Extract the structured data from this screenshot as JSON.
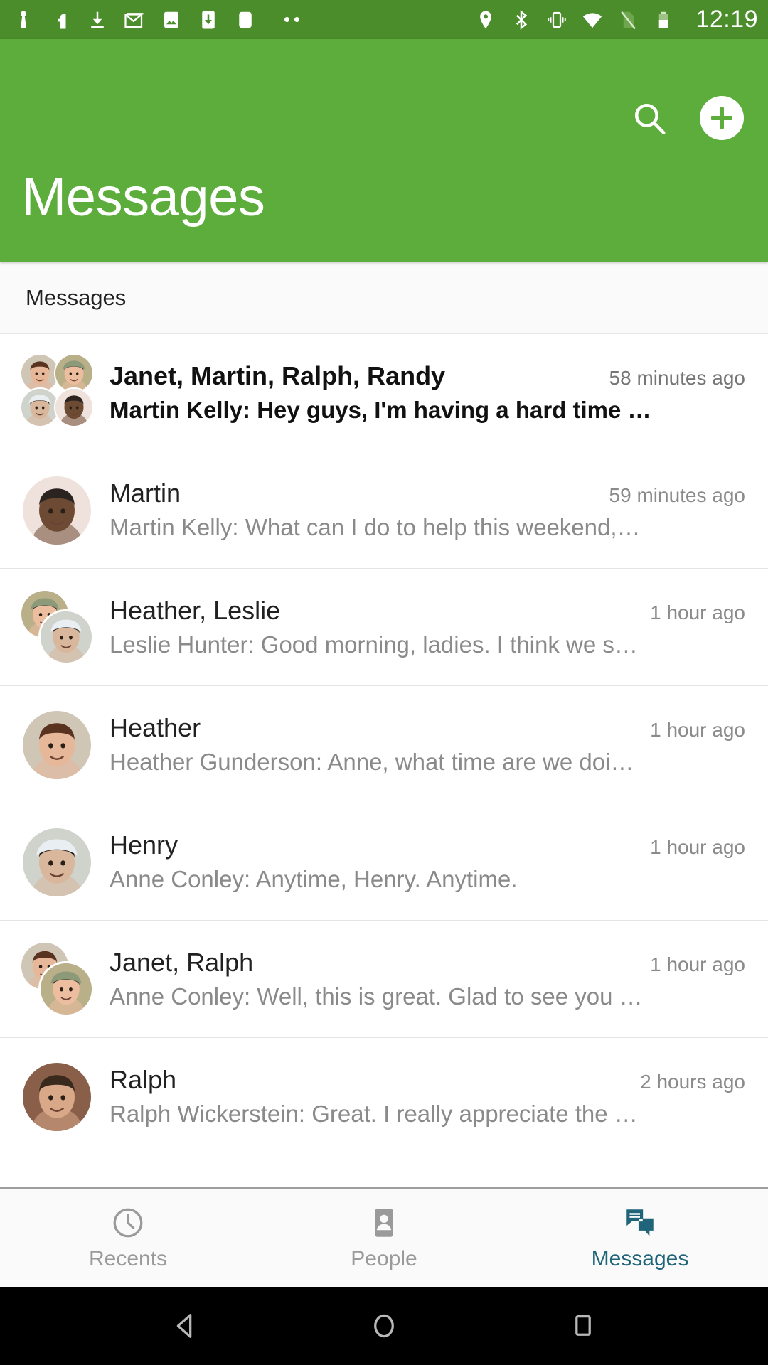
{
  "status_bar": {
    "time": "12:19",
    "background_color": "#4b8c2b",
    "left_icons": [
      "keyguard-icon",
      "facebook-icon",
      "download-icon",
      "gmail-icon",
      "photos-icon",
      "app-download-icon",
      "generic-notification-icon"
    ],
    "overflow_indicator": "more-notifications-dots",
    "right_icons": [
      "location-icon",
      "bluetooth-icon",
      "vibrate-icon",
      "wifi-icon",
      "no-sim-icon",
      "battery-icon"
    ]
  },
  "app_bar": {
    "title": "Messages",
    "background_color": "#5cad3c",
    "search_label": "Search",
    "add_label": "New conversation"
  },
  "section": {
    "header": "Messages"
  },
  "conversations": [
    {
      "title": "Janet, Martin, Ralph, Randy",
      "preview": "Martin Kelly: Hey guys, I'm having a hard time …",
      "timestamp": "58 minutes ago",
      "unread": true,
      "avatar_count": 4
    },
    {
      "title": "Martin",
      "preview": "Martin Kelly: What can I do to help this weekend,…",
      "timestamp": "59 minutes ago",
      "unread": false,
      "avatar_count": 1
    },
    {
      "title": "Heather, Leslie",
      "preview": "Leslie Hunter: Good morning, ladies. I think we s…",
      "timestamp": "1 hour ago",
      "unread": false,
      "avatar_count": 2
    },
    {
      "title": "Heather",
      "preview": "Heather Gunderson: Anne, what time are we doi…",
      "timestamp": "1 hour ago",
      "unread": false,
      "avatar_count": 1
    },
    {
      "title": "Henry",
      "preview": "Anne Conley: Anytime, Henry. Anytime.",
      "timestamp": "1 hour ago",
      "unread": false,
      "avatar_count": 1
    },
    {
      "title": "Janet, Ralph",
      "preview": "Anne Conley: Well, this is great. Glad to see you …",
      "timestamp": "1 hour ago",
      "unread": false,
      "avatar_count": 2
    },
    {
      "title": "Ralph",
      "preview": "Ralph Wickerstein: Great. I really appreciate the …",
      "timestamp": "2 hours ago",
      "unread": false,
      "avatar_count": 1
    }
  ],
  "bottom_nav": {
    "active_color": "#1f6479",
    "inactive_color": "#9a9a9a",
    "items": [
      {
        "label": "Recents",
        "icon": "clock-icon",
        "active": false
      },
      {
        "label": "People",
        "icon": "contact-icon",
        "active": false
      },
      {
        "label": "Messages",
        "icon": "chat-icon",
        "active": true
      }
    ]
  },
  "android_nav": {
    "back_label": "Back",
    "home_label": "Home",
    "recents_label": "Recent apps"
  }
}
